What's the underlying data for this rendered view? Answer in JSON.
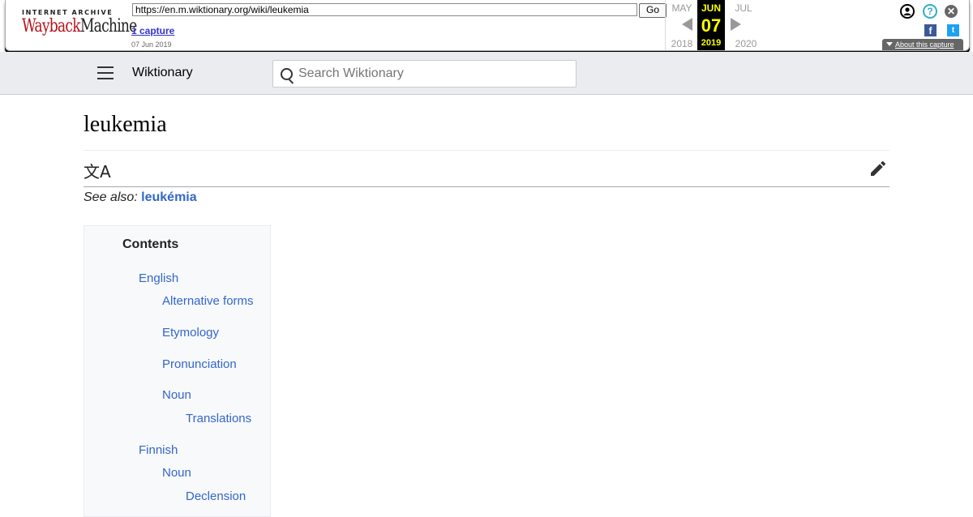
{
  "wayback": {
    "logo_top": "INTERNET ARCHIVE",
    "logo_wayback": "Wayback",
    "logo_machine": "Machine",
    "url": "https://en.m.wiktionary.org/wiki/leukemia",
    "go_label": "Go",
    "captures": "1 capture",
    "capture_date": "07 Jun 2019",
    "prev_month": "MAY",
    "prev_year": "2018",
    "cur_month": "JUN",
    "cur_day": "07",
    "cur_year": "2019",
    "next_month": "JUL",
    "next_year": "2020",
    "about": "About this capture",
    "help_glyph": "?",
    "close_glyph": "✕",
    "facebook_glyph": "f",
    "twitter_glyph": "t"
  },
  "header": {
    "site_name": "Wiktionary",
    "search_placeholder": "Search Wiktionary"
  },
  "page": {
    "title": "leukemia",
    "lang_glyph": "文A",
    "see_also_prefix": "See also: ",
    "see_also_link": "leukémia"
  },
  "toc": {
    "title": "Contents",
    "items": [
      {
        "label": "English",
        "level": 1
      },
      {
        "label": "Alternative forms",
        "level": 2
      },
      {
        "label": "Etymology",
        "level": 2
      },
      {
        "label": "Pronunciation",
        "level": 2
      },
      {
        "label": "Noun",
        "level": 2
      },
      {
        "label": "Translations",
        "level": 3
      },
      {
        "label": "Finnish",
        "level": 1
      },
      {
        "label": "Noun",
        "level": 2
      },
      {
        "label": "Declension",
        "level": 3
      }
    ]
  },
  "colors": {
    "link": "#3366cc",
    "header_bg": "#eaecf0",
    "wayback_highlight": "#ffff00"
  }
}
